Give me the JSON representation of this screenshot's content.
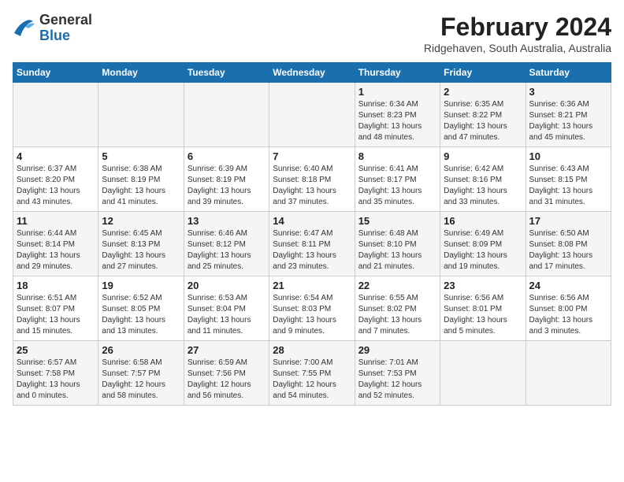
{
  "header": {
    "logo": {
      "general": "General",
      "blue": "Blue"
    },
    "title": "February 2024",
    "location": "Ridgehaven, South Australia, Australia"
  },
  "calendar": {
    "days_of_week": [
      "Sunday",
      "Monday",
      "Tuesday",
      "Wednesday",
      "Thursday",
      "Friday",
      "Saturday"
    ],
    "weeks": [
      [
        {
          "day": "",
          "info": ""
        },
        {
          "day": "",
          "info": ""
        },
        {
          "day": "",
          "info": ""
        },
        {
          "day": "",
          "info": ""
        },
        {
          "day": "1",
          "info": "Sunrise: 6:34 AM\nSunset: 8:23 PM\nDaylight: 13 hours\nand 48 minutes."
        },
        {
          "day": "2",
          "info": "Sunrise: 6:35 AM\nSunset: 8:22 PM\nDaylight: 13 hours\nand 47 minutes."
        },
        {
          "day": "3",
          "info": "Sunrise: 6:36 AM\nSunset: 8:21 PM\nDaylight: 13 hours\nand 45 minutes."
        }
      ],
      [
        {
          "day": "4",
          "info": "Sunrise: 6:37 AM\nSunset: 8:20 PM\nDaylight: 13 hours\nand 43 minutes."
        },
        {
          "day": "5",
          "info": "Sunrise: 6:38 AM\nSunset: 8:19 PM\nDaylight: 13 hours\nand 41 minutes."
        },
        {
          "day": "6",
          "info": "Sunrise: 6:39 AM\nSunset: 8:19 PM\nDaylight: 13 hours\nand 39 minutes."
        },
        {
          "day": "7",
          "info": "Sunrise: 6:40 AM\nSunset: 8:18 PM\nDaylight: 13 hours\nand 37 minutes."
        },
        {
          "day": "8",
          "info": "Sunrise: 6:41 AM\nSunset: 8:17 PM\nDaylight: 13 hours\nand 35 minutes."
        },
        {
          "day": "9",
          "info": "Sunrise: 6:42 AM\nSunset: 8:16 PM\nDaylight: 13 hours\nand 33 minutes."
        },
        {
          "day": "10",
          "info": "Sunrise: 6:43 AM\nSunset: 8:15 PM\nDaylight: 13 hours\nand 31 minutes."
        }
      ],
      [
        {
          "day": "11",
          "info": "Sunrise: 6:44 AM\nSunset: 8:14 PM\nDaylight: 13 hours\nand 29 minutes."
        },
        {
          "day": "12",
          "info": "Sunrise: 6:45 AM\nSunset: 8:13 PM\nDaylight: 13 hours\nand 27 minutes."
        },
        {
          "day": "13",
          "info": "Sunrise: 6:46 AM\nSunset: 8:12 PM\nDaylight: 13 hours\nand 25 minutes."
        },
        {
          "day": "14",
          "info": "Sunrise: 6:47 AM\nSunset: 8:11 PM\nDaylight: 13 hours\nand 23 minutes."
        },
        {
          "day": "15",
          "info": "Sunrise: 6:48 AM\nSunset: 8:10 PM\nDaylight: 13 hours\nand 21 minutes."
        },
        {
          "day": "16",
          "info": "Sunrise: 6:49 AM\nSunset: 8:09 PM\nDaylight: 13 hours\nand 19 minutes."
        },
        {
          "day": "17",
          "info": "Sunrise: 6:50 AM\nSunset: 8:08 PM\nDaylight: 13 hours\nand 17 minutes."
        }
      ],
      [
        {
          "day": "18",
          "info": "Sunrise: 6:51 AM\nSunset: 8:07 PM\nDaylight: 13 hours\nand 15 minutes."
        },
        {
          "day": "19",
          "info": "Sunrise: 6:52 AM\nSunset: 8:05 PM\nDaylight: 13 hours\nand 13 minutes."
        },
        {
          "day": "20",
          "info": "Sunrise: 6:53 AM\nSunset: 8:04 PM\nDaylight: 13 hours\nand 11 minutes."
        },
        {
          "day": "21",
          "info": "Sunrise: 6:54 AM\nSunset: 8:03 PM\nDaylight: 13 hours\nand 9 minutes."
        },
        {
          "day": "22",
          "info": "Sunrise: 6:55 AM\nSunset: 8:02 PM\nDaylight: 13 hours\nand 7 minutes."
        },
        {
          "day": "23",
          "info": "Sunrise: 6:56 AM\nSunset: 8:01 PM\nDaylight: 13 hours\nand 5 minutes."
        },
        {
          "day": "24",
          "info": "Sunrise: 6:56 AM\nSunset: 8:00 PM\nDaylight: 13 hours\nand 3 minutes."
        }
      ],
      [
        {
          "day": "25",
          "info": "Sunrise: 6:57 AM\nSunset: 7:58 PM\nDaylight: 13 hours\nand 0 minutes."
        },
        {
          "day": "26",
          "info": "Sunrise: 6:58 AM\nSunset: 7:57 PM\nDaylight: 12 hours\nand 58 minutes."
        },
        {
          "day": "27",
          "info": "Sunrise: 6:59 AM\nSunset: 7:56 PM\nDaylight: 12 hours\nand 56 minutes."
        },
        {
          "day": "28",
          "info": "Sunrise: 7:00 AM\nSunset: 7:55 PM\nDaylight: 12 hours\nand 54 minutes."
        },
        {
          "day": "29",
          "info": "Sunrise: 7:01 AM\nSunset: 7:53 PM\nDaylight: 12 hours\nand 52 minutes."
        },
        {
          "day": "",
          "info": ""
        },
        {
          "day": "",
          "info": ""
        }
      ]
    ]
  }
}
